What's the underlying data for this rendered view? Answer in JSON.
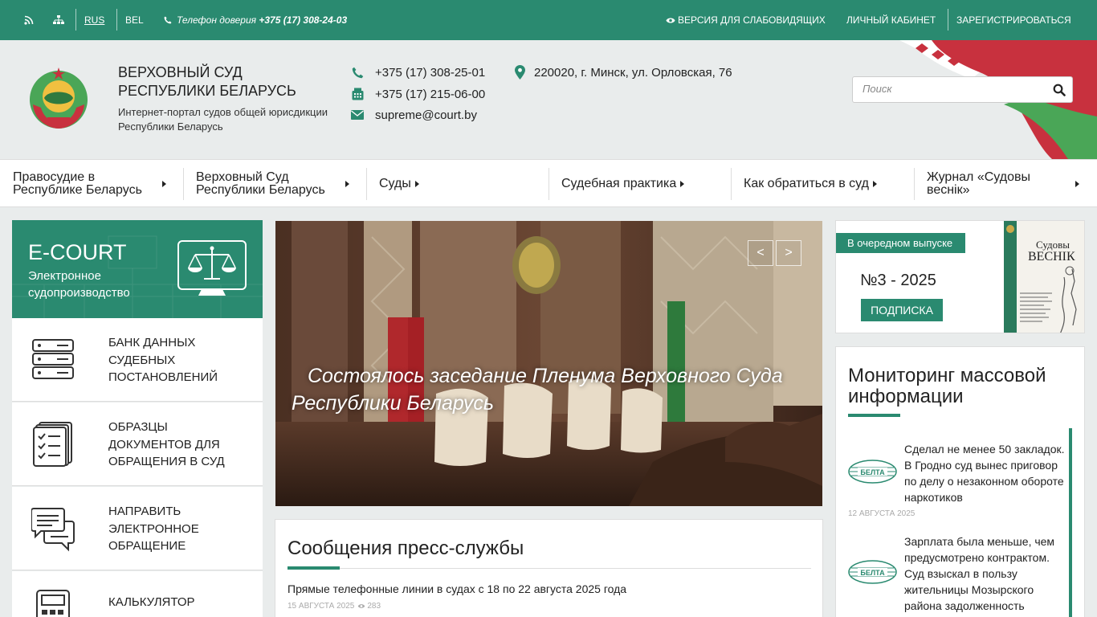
{
  "topbar": {
    "lang_ru": "RUS",
    "lang_bel": "BEL",
    "phone_label": "Телефон доверия",
    "phone_number": "+375 (17) 308-24-03",
    "vision": "ВЕРСИЯ ДЛЯ СЛАБОВИДЯЩИХ",
    "cabinet": "ЛИЧНЫЙ КАБИНЕТ",
    "register": "ЗАРЕГИСТРИРОВАТЬСЯ",
    "icons": [
      "rss-icon",
      "sitemap-icon",
      "phone-icon",
      "eye-icon"
    ]
  },
  "header": {
    "title_line1": "ВЕРХОВНЫЙ СУД",
    "title_line2": "РЕСПУБЛИКИ БЕЛАРУСЬ",
    "subtitle_line1": "Интернет-портал судов общей юрисдикции",
    "subtitle_line2": "Республики Беларусь",
    "phone1": "+375 (17) 308-25-01",
    "phone2": "+375 (17) 215-06-00",
    "email": "supreme@court.by",
    "address": "220020, г. Минск, ул. Орловская, 76",
    "search_placeholder": "Поиск"
  },
  "nav": {
    "items": [
      {
        "line1": "Правосудие в",
        "line2": "Республике Беларусь"
      },
      {
        "line1": "Верховный Суд",
        "line2": "Республики Беларусь"
      },
      {
        "line1": "Суды",
        "line2": ""
      },
      {
        "line1": "Судебная практика",
        "line2": ""
      },
      {
        "line1": "Как обратиться в суд",
        "line2": ""
      },
      {
        "line1": "Журнал «Судовы",
        "line2": "веснік»"
      }
    ]
  },
  "ecourt": {
    "title": "E-COURT",
    "subtitle_line1": "Электронное",
    "subtitle_line2": "судопроизводство"
  },
  "services": [
    {
      "line1": "БАНК ДАННЫХ",
      "line2": "СУДЕБНЫХ",
      "line3": "ПОСТАНОВЛЕНИЙ",
      "icon": "server-icon"
    },
    {
      "line1": "ОБРАЗЦЫ",
      "line2": "ДОКУМЕНТОВ ДЛЯ",
      "line3": "ОБРАЩЕНИЯ В СУД",
      "icon": "documents-checklist-icon"
    },
    {
      "line1": "НАПРАВИТЬ",
      "line2": "ЭЛЕКТРОННОЕ",
      "line3": "ОБРАЩЕНИЕ",
      "icon": "chat-bubbles-icon"
    },
    {
      "line1": "КАЛЬКУЛЯТОР",
      "line2": "",
      "line3": "",
      "icon": "calculator-icon"
    }
  ],
  "slider": {
    "caption_line1": "Состоялось заседание Пленума Верховного Суда",
    "caption_line2": "Республики Беларусь",
    "prev": "<",
    "next": ">"
  },
  "press": {
    "title": "Сообщения пресс-службы",
    "item_title": "Прямые телефонные линии в судах с 18 по 22 августа 2025 года",
    "item_date": "15 АВГУСТА 2025",
    "item_views": "283"
  },
  "journal": {
    "tag": "В очередном выпуске",
    "issue": "№3 - 2025",
    "subscribe": "ПОДПИСКА",
    "cover_title_line1": "Судовы",
    "cover_title_line2": "ВЕСНІК"
  },
  "monitoring": {
    "title": "Мониторинг массовой информации",
    "items": [
      {
        "text": "Сделал не менее 50 закладок. В Гродно суд вынес приговор по делу о незаконном обороте наркотиков",
        "date": "12 АВГУСТА 2025",
        "source": "БЕЛТА"
      },
      {
        "text": "Зарплата была меньше, чем предусмотрено контрактом. Суд взыскал в пользу жительницы Мозырского района задолженность",
        "date": "",
        "source": "БЕЛТА"
      }
    ]
  },
  "colors": {
    "accent": "#2a8a70",
    "flag_red": "#c8313e",
    "flag_green": "#4aa657"
  }
}
